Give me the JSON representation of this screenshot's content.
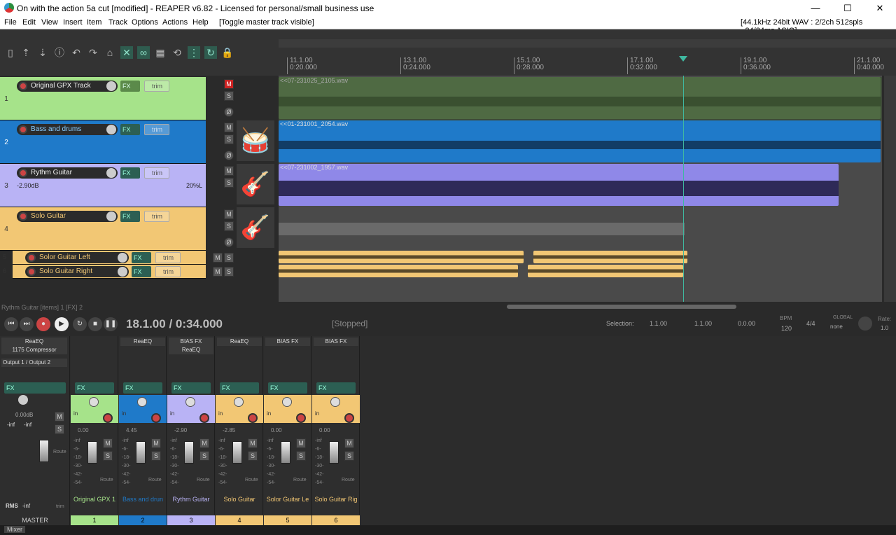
{
  "window": {
    "title": "On with the action 5a cut [modified] - REAPER v6.82 - Licensed for personal/small business use",
    "minimize": "—",
    "maximize": "☐",
    "close": "✕"
  },
  "menu": {
    "items": [
      "File",
      "Edit",
      "View",
      "Insert",
      "Item",
      "Track",
      "Options",
      "Actions",
      "Help"
    ],
    "toggle_master": "[Toggle master track visible]",
    "audio_status": "[44.1kHz 24bit WAV : 2/2ch 512spls ~24/24ms ASIO]"
  },
  "ruler": {
    "marks": [
      {
        "bar": "11.1.00",
        "time": "0:20.000"
      },
      {
        "bar": "13.1.00",
        "time": "0:24.000"
      },
      {
        "bar": "15.1.00",
        "time": "0:28.000"
      },
      {
        "bar": "17.1.00",
        "time": "0:32.000"
      },
      {
        "bar": "19.1.00",
        "time": "0:36.000"
      },
      {
        "bar": "21.1.00",
        "time": "0:40.000"
      }
    ]
  },
  "tracks": [
    {
      "num": "1",
      "name": "Original GPX Track",
      "color": "#a6e38a",
      "item": "<<07-231025_2105.wav",
      "fx": "FX",
      "trim": "trim"
    },
    {
      "num": "2",
      "name": "Bass and drums",
      "color": "#1f7ac9",
      "item": "<<01-231001_2054.wav",
      "fx": "FX",
      "trim": "trim"
    },
    {
      "num": "3",
      "name": "Rythm Guitar",
      "color": "#b9b3f5",
      "item": "<<07-231002_1957.wav",
      "vol": "-2.90dB",
      "pan": "20%L",
      "fx": "FX",
      "trim": "trim"
    },
    {
      "num": "4",
      "name": "Solo Guitar",
      "color": "#f2c774",
      "fx": "FX",
      "trim": "trim"
    },
    {
      "num": "5",
      "name": "Solor Guitar Left",
      "color": "#f2c774",
      "fx": "FX",
      "trim": "trim"
    },
    {
      "num": "6",
      "name": "Solo Guitar Right",
      "color": "#f2c774",
      "fx": "FX",
      "trim": "trim"
    }
  ],
  "track_buttons": {
    "mute": "M",
    "solo": "S",
    "phase": "Ø"
  },
  "hint": "Rythm Guitar [items] 1 [FX] 2",
  "transport": {
    "position": "18.1.00 / 0:34.000",
    "state": "[Stopped]",
    "selection_label": "Selection:",
    "sel_start": "1.1.00",
    "sel_end": "1.1.00",
    "sel_len": "0.0.00",
    "bpm_label": "BPM",
    "bpm": "120",
    "timesig": "4/4",
    "global_label": "GLOBAL",
    "global_value": "none",
    "rate_label": "Rate:",
    "rate": "1.0"
  },
  "mixer": {
    "master": {
      "name": "MASTER",
      "fx": [
        "ReaEQ",
        "1175 Compressor"
      ],
      "output": "Output 1 / Output 2",
      "vol": "0.00dB",
      "peak_l": "-inf",
      "peak_r": "-inf",
      "rms_label": "RMS",
      "rms": "-inf",
      "route": "Route",
      "trim": "trim"
    },
    "channels": [
      {
        "name": "Original GPX 1",
        "num": "1",
        "color": "#a6e38a",
        "fx": [],
        "vol": "0.00"
      },
      {
        "name": "Bass and drun",
        "num": "2",
        "color": "#1f7ac9",
        "fx": [
          "ReaEQ"
        ],
        "vol": "4.45"
      },
      {
        "name": "Rythm Guitar",
        "num": "3",
        "color": "#b9b3f5",
        "fx": [
          "BIAS FX",
          "ReaEQ"
        ],
        "vol": "-2.90"
      },
      {
        "name": "Solo Guitar",
        "num": "4",
        "color": "#f2c774",
        "fx": [
          "ReaEQ"
        ],
        "vol": "-2.85"
      },
      {
        "name": "Solor Guitar Le",
        "num": "5",
        "color": "#f2c774",
        "fx": [
          "BIAS FX"
        ],
        "vol": "0.00"
      },
      {
        "name": "Solo Guitar Rig",
        "num": "6",
        "color": "#f2c774",
        "fx": [
          "BIAS FX"
        ],
        "vol": "0.00"
      }
    ],
    "in_label": "in",
    "fx_label": "FX",
    "route_label": "Route",
    "meter_scale": [
      "-inf",
      "-6-",
      "-18-",
      "-30-",
      "-42-",
      "-54-"
    ]
  },
  "statusbar": {
    "tab": "Mixer"
  }
}
